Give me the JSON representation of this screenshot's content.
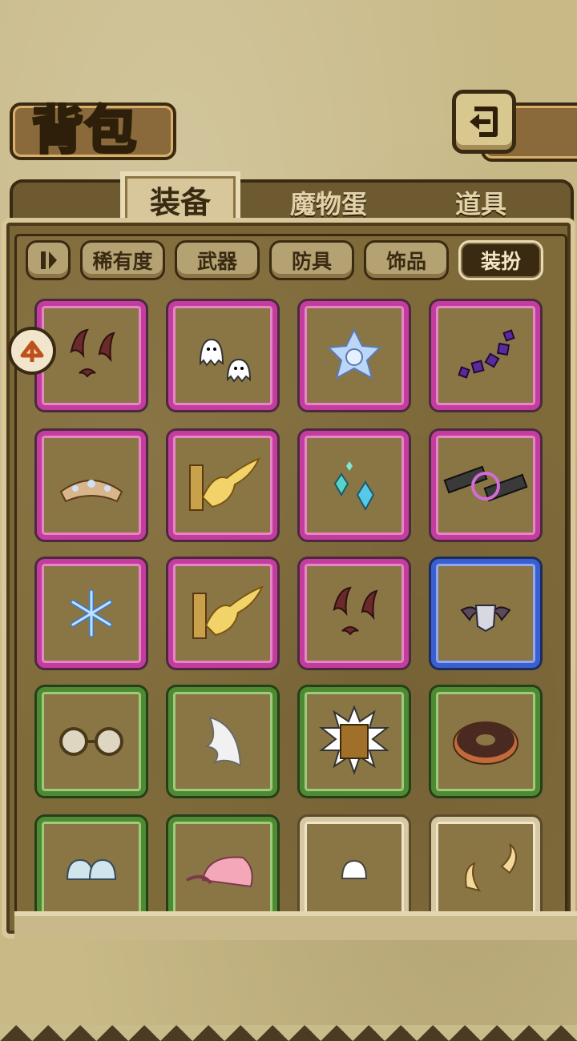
{
  "header": {
    "title": "背包"
  },
  "tabs": [
    {
      "label": "装备",
      "active": true
    },
    {
      "label": "魔物蛋",
      "active": false
    },
    {
      "label": "道具",
      "active": false
    }
  ],
  "filters": [
    {
      "label": "稀有度"
    },
    {
      "label": "武器"
    },
    {
      "label": "防具"
    },
    {
      "label": "饰品"
    },
    {
      "label": "装扮",
      "active": true
    }
  ],
  "items": [
    {
      "name": "bats",
      "rarity": "pink"
    },
    {
      "name": "ghosts",
      "rarity": "pink"
    },
    {
      "name": "ice-flower",
      "rarity": "pink"
    },
    {
      "name": "purple-gems",
      "rarity": "pink"
    },
    {
      "name": "tiara",
      "rarity": "pink"
    },
    {
      "name": "golden-dove-emblem",
      "rarity": "pink"
    },
    {
      "name": "crystals",
      "rarity": "pink"
    },
    {
      "name": "mech-gun",
      "rarity": "pink"
    },
    {
      "name": "snowflake",
      "rarity": "pink"
    },
    {
      "name": "golden-dove-emblem",
      "rarity": "pink"
    },
    {
      "name": "bats",
      "rarity": "pink"
    },
    {
      "name": "winged-helmet",
      "rarity": "blue"
    },
    {
      "name": "round-glasses",
      "rarity": "green"
    },
    {
      "name": "white-wing",
      "rarity": "green"
    },
    {
      "name": "tribal-mask",
      "rarity": "green"
    },
    {
      "name": "donut",
      "rarity": "green"
    },
    {
      "name": "shells",
      "rarity": "green"
    },
    {
      "name": "pink-cap",
      "rarity": "green"
    },
    {
      "name": "small-shell",
      "rarity": "beige"
    },
    {
      "name": "horns",
      "rarity": "beige"
    }
  ],
  "colors": {
    "pink": "#c43d9e",
    "blue": "#3a5fd1",
    "green": "#4f8a32",
    "beige": "#d6c8a2"
  }
}
